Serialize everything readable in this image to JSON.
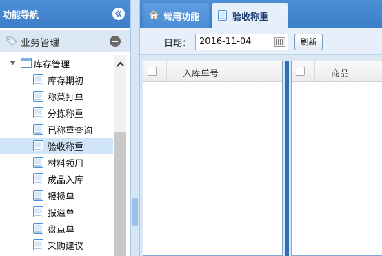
{
  "sidebar": {
    "title": "功能导航",
    "section": "业务管理",
    "tree_root": "库存管理",
    "items": [
      {
        "label": "库存期初"
      },
      {
        "label": "称菜打单"
      },
      {
        "label": "分拣称重"
      },
      {
        "label": "已称重查询"
      },
      {
        "label": "验收称重",
        "selected": true
      },
      {
        "label": "材料领用"
      },
      {
        "label": "成品入库"
      },
      {
        "label": "报损单"
      },
      {
        "label": "报溢单"
      },
      {
        "label": "盘点单"
      },
      {
        "label": "采购建议"
      }
    ]
  },
  "tabs": [
    {
      "label": "常用功能",
      "icon": "home-icon"
    },
    {
      "label": "验收称重",
      "icon": "document-icon",
      "active": true
    }
  ],
  "toolbar": {
    "date_label": "日期：",
    "date_value": "2016-11-04",
    "refresh_label": "刷新"
  },
  "grids": {
    "left": {
      "column": "入库单号"
    },
    "right": {
      "column": "商品"
    }
  },
  "colors": {
    "header_blue": "#4d8fd6",
    "selected_row": "#cfe4f7",
    "toolbar_bg": "#e6effa",
    "separator_blue": "#2f6fb5"
  }
}
